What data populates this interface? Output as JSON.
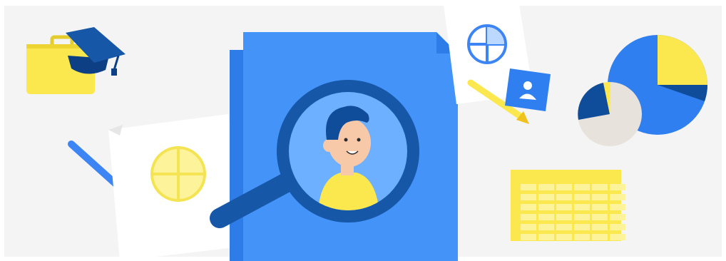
{
  "scene": {
    "colors": {
      "background": "#f4f4f4",
      "frame": "#ffffff",
      "document_blue": "#4393f8",
      "document_blue_dark": "#2e7ce8",
      "lens_ring": "#1657a8",
      "lens_fill": "#6cb0ff",
      "yellow": "#fbe84e",
      "yellow_light": "#fdf39a",
      "navy": "#0f4c9a",
      "pie_blue": "#2f7ff0",
      "pie_beige": "#e8e2dc",
      "paper": "#ffffff",
      "skin": "#f7c9a8",
      "hair": "#0f4c9a"
    },
    "icons": [
      "briefcase-icon",
      "graduation-cap-icon",
      "pencil-icon",
      "pie-chart-icon",
      "user-card-icon",
      "magnifying-glass-icon",
      "spreadsheet-icon"
    ]
  }
}
